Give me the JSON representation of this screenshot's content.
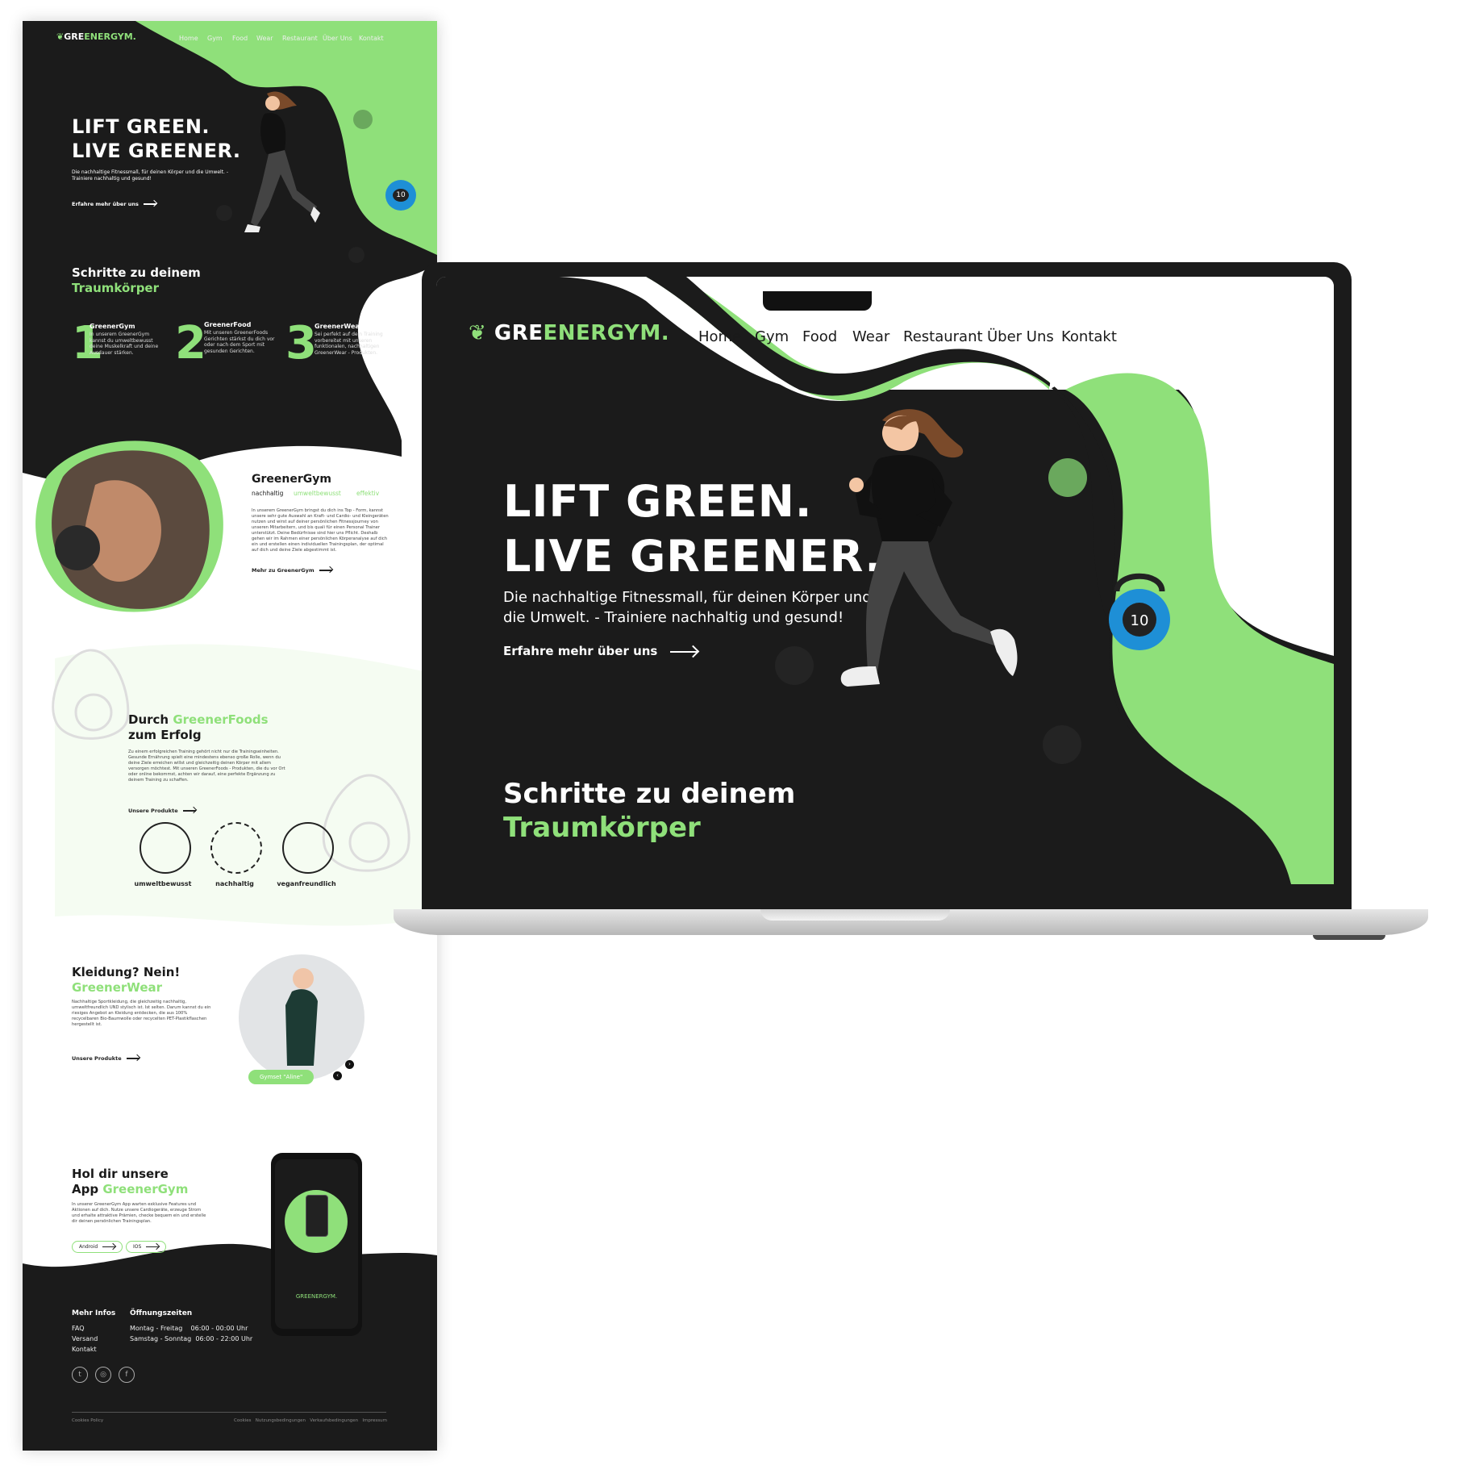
{
  "brand": {
    "prefix": "GRE",
    "accent": "ENERGYM",
    "dot": "."
  },
  "nav": {
    "home": "Home",
    "gym": "Gym",
    "food": "Food",
    "wear": "Wear",
    "restaurant": "Restaurant",
    "about": "Über Uns",
    "contact": "Kontakt"
  },
  "hero": {
    "line1": "LIFT GREEN.",
    "line2": "LIVE GREENER.",
    "subtitle": "Die nachhaltige Fitnessmall, für deinen Körper und die Umwelt. - Trainiere nachhaltig und gesund!",
    "cta": "Erfahre mehr über uns",
    "kettlebell_number": "10"
  },
  "steps": {
    "title_line1": "Schritte zu deinem",
    "title_line2": "Traumkörper",
    "items": [
      {
        "number": "1",
        "title": "GreenerGym",
        "text": "In unserem GreenerGym kannst du umweltbewusst deine Muskelkraft und deine Ausdauer stärken."
      },
      {
        "number": "2",
        "title": "GreenerFood",
        "text": "Mit unseren GreenerFoods Gerichten stärkst du dich vor oder nach dem Sport mit gesunden Gerichten."
      },
      {
        "number": "3",
        "title": "GreenerWear",
        "text": "Sei perfekt auf dein Training vorbereitet mit unseren funktionalen, nachhaltigen GreenerWear - Produkten."
      }
    ]
  },
  "gym": {
    "title": "GreenerGym",
    "tags": [
      "nachhaltig",
      "umweltbewusst",
      "effektiv"
    ],
    "body": "In unserem GreenerGym bringst du dich ins Top - Form, kannst unsere sehr gute Auswahl an Kraft- und Cardio- und Kleingeräten nutzen und wirst auf deiner persönlichen Fitnessjourney von unseren Mitarbeitern, und bis quali für einen Personal Trainer unterstützt. Deine Bedürfnisse sind hier uns Pflicht. Deshalb gehen wir im Rahmen einer persönlichen Körperanalyse auf dich ein und erstellen einen individuellen Trainingsplan, der optimal auf dich und deine Ziele abgestimmt ist.",
    "cta": "Mehr zu GreenerGym"
  },
  "food": {
    "title_prefix": "Durch ",
    "title_accent": "GreenerFoods",
    "title_line2": "zum Erfolg",
    "body": "Zu einem erfolgreichen Training gehört nicht nur die Trainingseinheiten. Gesunde Ernährung spielt eine mindestens ebenso große Rolle, wenn du deine Ziele erreichen willst und gleichzeitig deinen Körper mit allem versorgen möchtest. Mit unseren GreenerFoods - Produkten, die du vor Ort oder online bekommst, achten wir darauf, eine perfekte Ergänzung zu deinem Training zu schaffen.",
    "cta": "Unsere Produkte",
    "features": [
      "umweltbewusst",
      "nachhaltig",
      "veganfreundlich"
    ]
  },
  "wear": {
    "title_line1": "Kleidung? Nein!",
    "title_line2": "GreenerWear",
    "body": "Nachhaltige Sportkleidung, die gleichzeitig nachhaltig, umweltfreundlich UND stylisch ist. Ist selten. Darum kannst du ein riesiges Angebot an Kleidung entdecken, die aus 100% recycelbaren Bio-Baumwolle oder recycelten PET-Plastikflaschen hergestellt ist.",
    "cta": "Unsere Produkte",
    "product_badge": "Gymset \"Aline\""
  },
  "app": {
    "title_line1": "Hol dir unsere",
    "title_prefix": "App ",
    "title_accent": "GreenerGym",
    "body": "In unserer GreenerGym App warten exklusive Features und Aktionen auf dich. Nutze unsere Cardiogeräte, erzeuge Strom und erhalte attraktive Prämien, checke bequem ein und erstelle dir deinen persönlichen Trainingsplan.",
    "android": "Android",
    "ios": "IOS",
    "phone_brand": "GREENERGYM."
  },
  "footer": {
    "info_title": "Mehr Infos",
    "info_links": [
      "FAQ",
      "Versand",
      "Kontakt"
    ],
    "hours_title": "Öffnungszeiten",
    "hours": [
      {
        "days": "Montag - Freitag",
        "time": "06:00 - 00:00 Uhr"
      },
      {
        "days": "Samstag - Sonntag",
        "time": "06:00 - 22:00 Uhr"
      }
    ],
    "social_icons": [
      "twitter-icon",
      "instagram-icon",
      "facebook-icon"
    ],
    "legal_left": "Cookies Policy",
    "legal_right": [
      "Cookies",
      "Nutzungsbedingungen",
      "Verkaufsbedingungen",
      "Impressum"
    ]
  },
  "colors": {
    "accent": "#8fe07a",
    "dark": "#1b1b1b",
    "kettlebell": "#1e8fd6"
  }
}
